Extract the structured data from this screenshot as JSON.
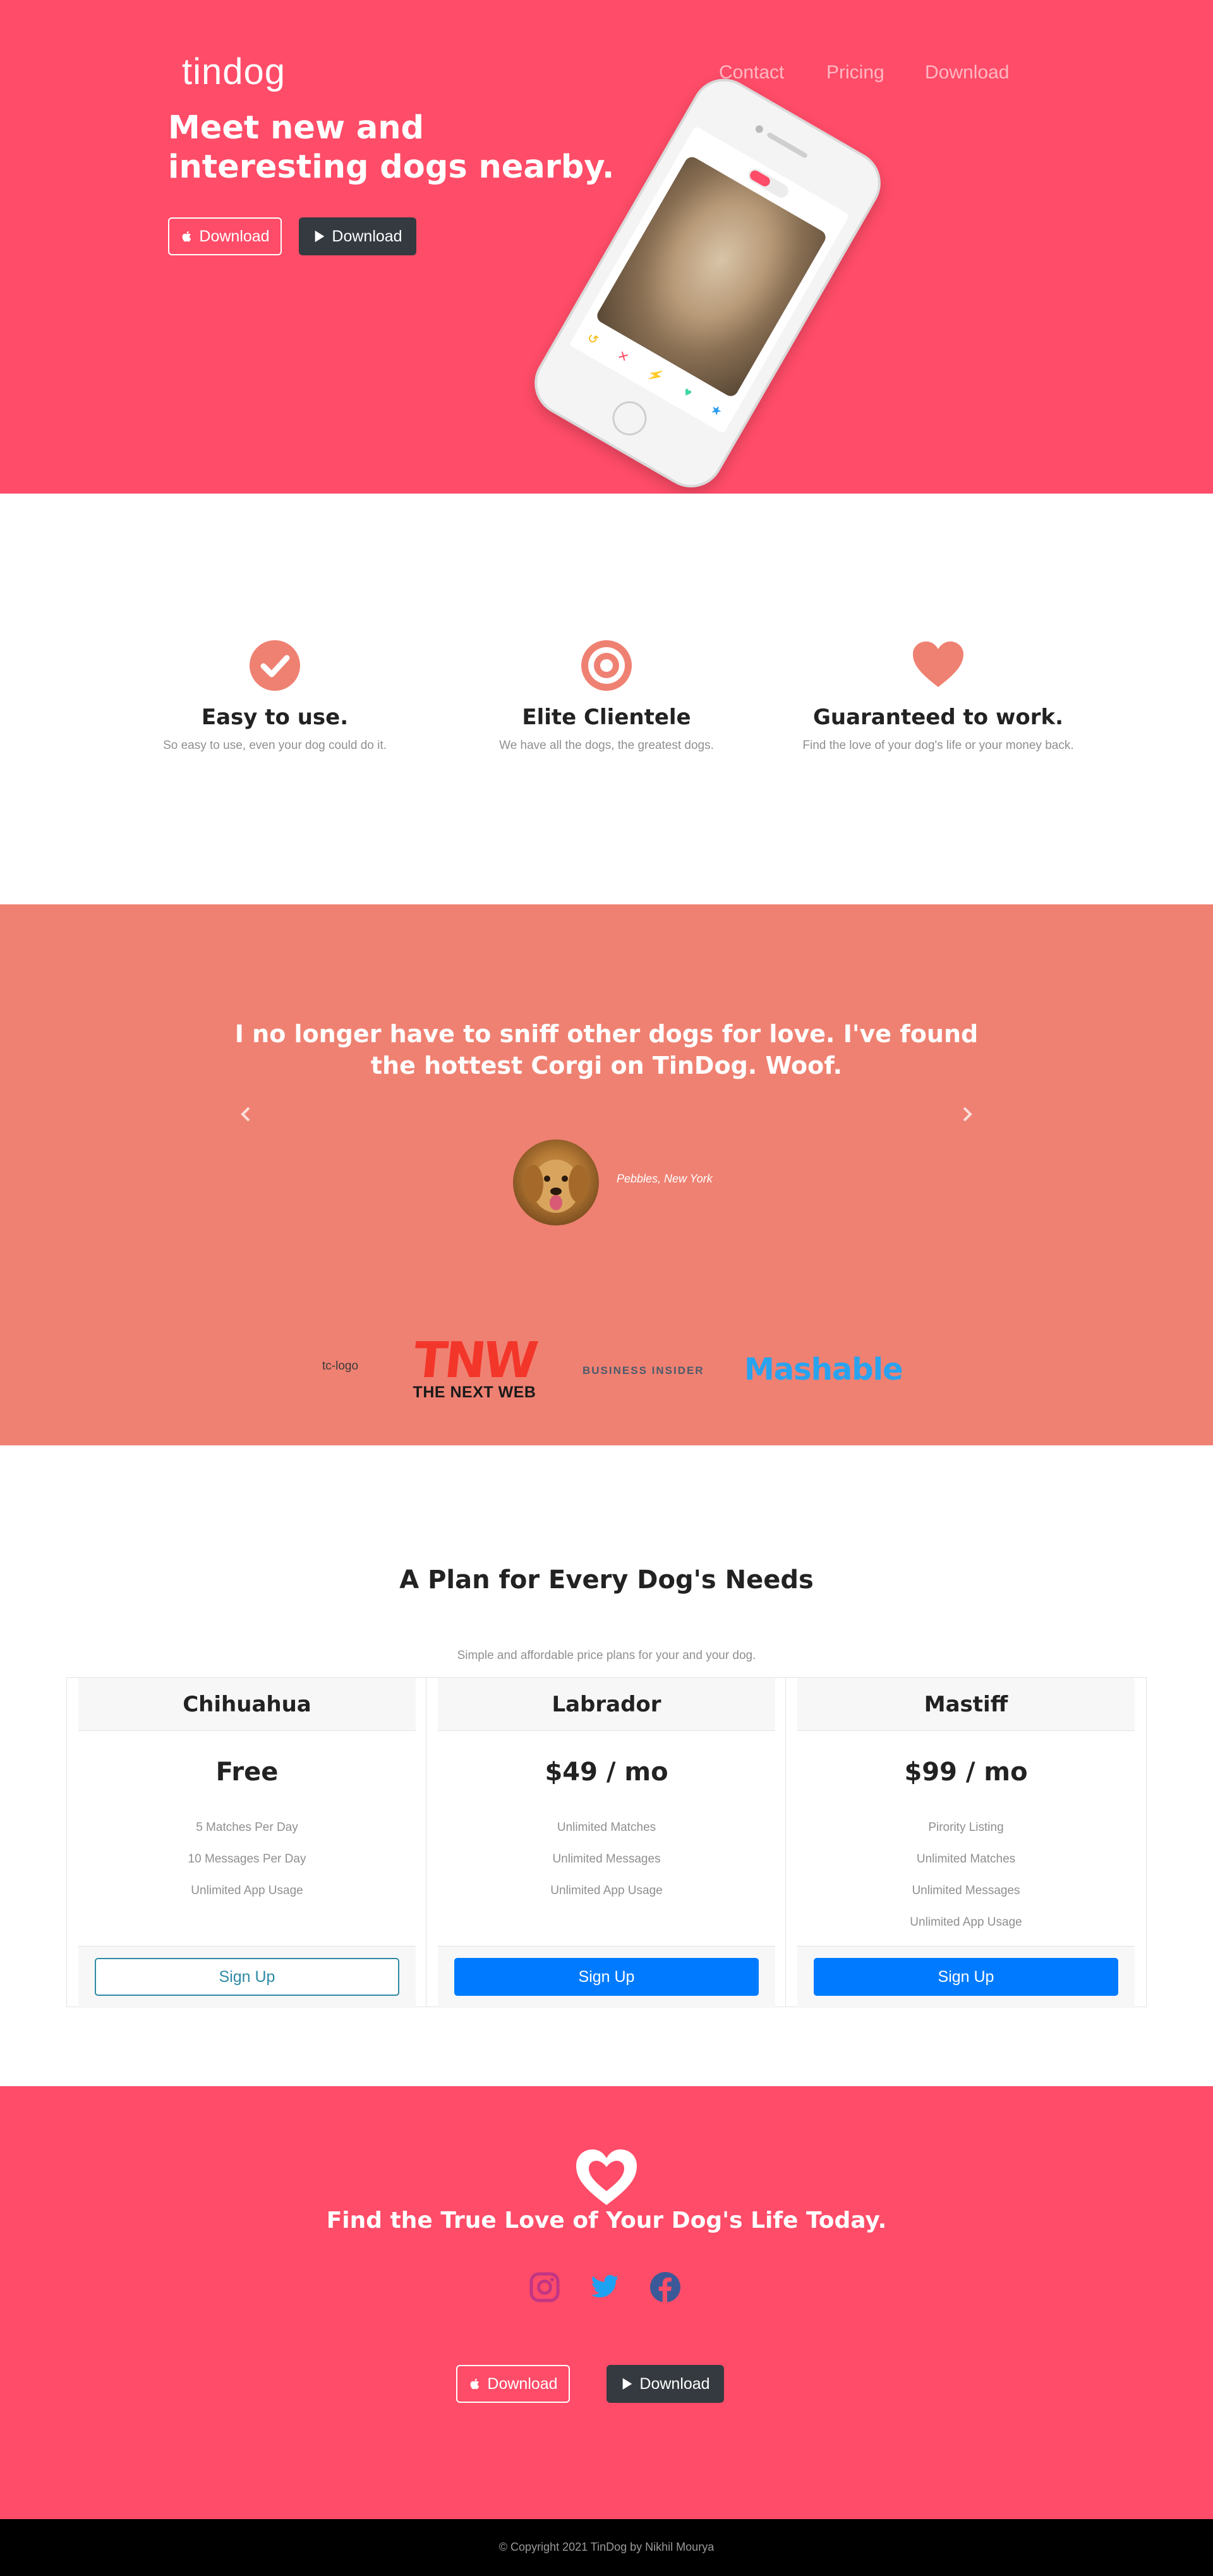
{
  "hero": {
    "brand": "tindog",
    "nav": {
      "contact": "Contact",
      "pricing": "Pricing",
      "download": "Download"
    },
    "title": "Meet new and interesting dogs nearby.",
    "apple_download": "Download",
    "google_download": "Download"
  },
  "features": [
    {
      "icon": "check-circle-icon",
      "title": "Easy to use.",
      "text": "So easy to use, even your dog could do it."
    },
    {
      "icon": "bullseye-icon",
      "title": "Elite Clientele",
      "text": "We have all the dogs, the greatest dogs."
    },
    {
      "icon": "heart-icon",
      "title": "Guaranteed to work.",
      "text": "Find the love of your dog's life or your money back."
    }
  ],
  "testimonial": {
    "quote": "I no longer have to sniff other dogs for love. I've found the hottest Corgi on TinDog. Woof.",
    "name": "Pebbles, New York"
  },
  "press": {
    "tc_alt": "tc-logo",
    "tnw_logo": "TNW",
    "tnw_caption": "THE NEXT WEB",
    "bi": "BUSINESS INSIDER",
    "mashable": "Mashable"
  },
  "pricing": {
    "title": "A Plan for Every Dog's Needs",
    "subtitle": "Simple and affordable price plans for your and your dog.",
    "plans": [
      {
        "name": "Chihuahua",
        "price": "Free",
        "features": [
          "5 Matches Per Day",
          "10 Messages Per Day",
          "Unlimited App Usage"
        ],
        "button": "Sign Up"
      },
      {
        "name": "Labrador",
        "price": "$49 / mo",
        "features": [
          "Unlimited Matches",
          "Unlimited Messages",
          "Unlimited App Usage"
        ],
        "button": "Sign Up"
      },
      {
        "name": "Mastiff",
        "price": "$99 / mo",
        "features": [
          "Pirority Listing",
          "Unlimited Matches",
          "Unlimited Messages",
          "Unlimited App Usage"
        ],
        "button": "Sign Up"
      }
    ]
  },
  "cta": {
    "title": "Find the True Love of Your Dog's Life Today.",
    "apple_download": "Download",
    "google_download": "Download"
  },
  "footer": {
    "copyright": "© Copyright 2021 TinDog by Nikhil Mourya"
  },
  "colors": {
    "hero_bg": "#ff4c68",
    "accent": "#ef8172",
    "primary_button": "#007bff",
    "dark_button": "#343a40",
    "footer_bg": "#000000"
  }
}
